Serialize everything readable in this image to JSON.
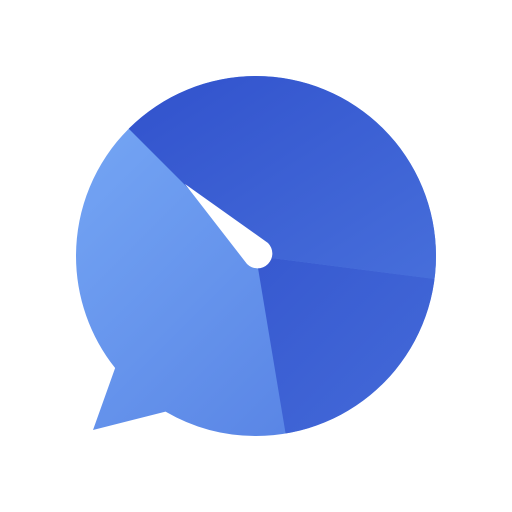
{
  "app": {
    "icon": "speech-bubble-speedometer-icon",
    "colors": {
      "background": "#ffffff",
      "dark_blue": "#2f4fcb",
      "mid_blue": "#4a73dd",
      "light_blue": "#7fb2fa",
      "needle": "#ffffff"
    }
  }
}
